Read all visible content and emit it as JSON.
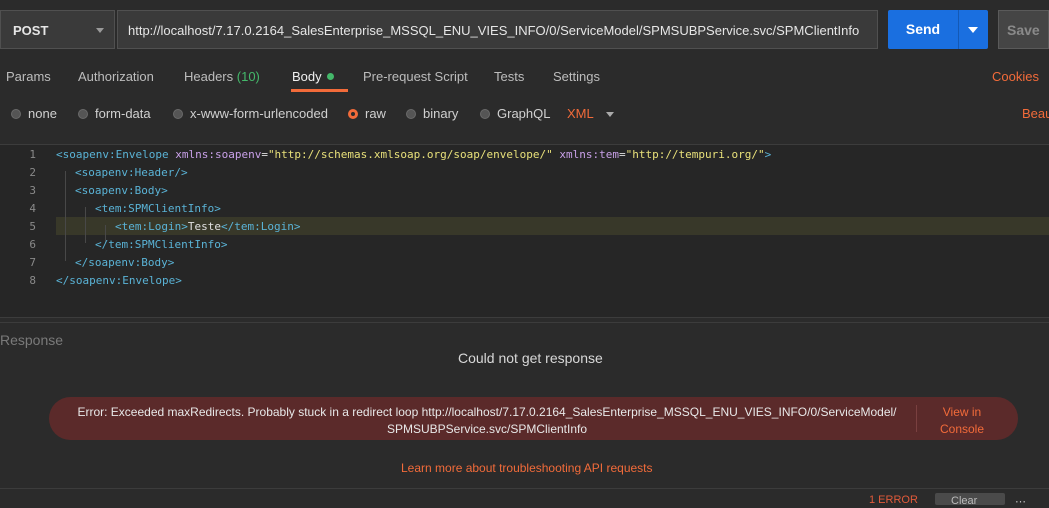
{
  "request": {
    "method": "POST",
    "url": "http://localhost/7.17.0.2164_SalesEnterprise_MSSQL_ENU_VIES_INFO/0/ServiceModel/SPMSUBPService.svc/SPMClientInfo",
    "send_label": "Send",
    "save_label": "Save"
  },
  "tabs": {
    "params": "Params",
    "authorization": "Authorization",
    "headers": "Headers",
    "headers_count": "(10)",
    "body": "Body",
    "prerequest": "Pre-request Script",
    "tests": "Tests",
    "settings": "Settings",
    "cookies": "Cookies"
  },
  "body_types": {
    "none": "none",
    "form_data": "form-data",
    "urlencoded": "x-www-form-urlencoded",
    "raw": "raw",
    "binary": "binary",
    "graphql": "GraphQL",
    "selected": "raw",
    "format": "XML",
    "beautify": "Beau"
  },
  "editor": {
    "line_numbers": [
      "1",
      "2",
      "3",
      "4",
      "5",
      "6",
      "7",
      "8"
    ],
    "l1_open": "<soapenv:Envelope",
    "l1_attr1": "xmlns:soapenv",
    "l1_eq1": "=",
    "l1_val1": "\"http://schemas.xmlsoap.org/soap/envelope/\"",
    "l1_attr2": "xmlns:tem",
    "l1_eq2": "=",
    "l1_val2": "\"http://tempuri.org/\"",
    "l1_close": ">",
    "l2": "<soapenv:Header/>",
    "l3": "<soapenv:Body>",
    "l4": "<tem:SPMClientInfo>",
    "l5_open": "<tem:Login>",
    "l5_text": "Teste",
    "l5_close": "</tem:Login>",
    "l6": "</tem:SPMClientInfo>",
    "l7": "</soapenv:Body>",
    "l8": "</soapenv:Envelope>"
  },
  "response": {
    "title": "Response",
    "could_not": "Could not get response",
    "error_line1": "Error: Exceeded maxRedirects. Probably stuck in a redirect loop http://localhost/7.17.0.2164_SalesEnterprise_MSSQL_ENU_VIES_INFO/0/ServiceModel/",
    "error_line2": "SPMSUBPService.svc/SPMClientInfo",
    "view_in": "View in",
    "console": "Console",
    "learn_more": "Learn more about troubleshooting API requests"
  },
  "status_bar": {
    "error_count": "1 ERROR",
    "clear": "Clear"
  },
  "colors": {
    "accent": "#f26b3a",
    "send": "#1a6fe0",
    "error_bg": "#5b2a2a",
    "ok_green": "#44b86a"
  }
}
